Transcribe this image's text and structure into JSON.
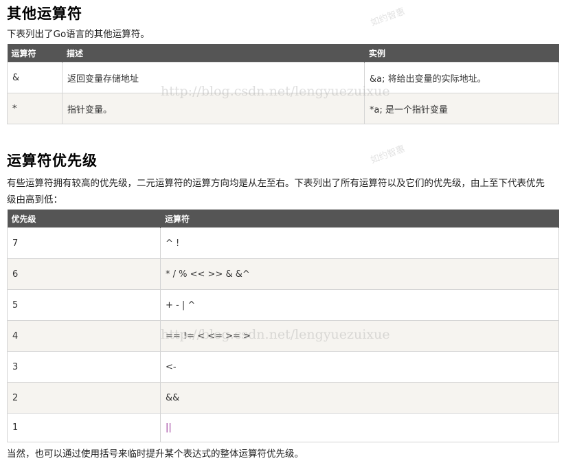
{
  "section1": {
    "title": "其他运算符",
    "intro": "下表列出了Go语言的其他运算符。",
    "headers": [
      "运算符",
      "描述",
      "实例"
    ],
    "rows": [
      [
        "&",
        "返回变量存储地址",
        "&a; 将给出变量的实际地址。"
      ],
      [
        "*",
        "指针变量。",
        "*a; 是一个指针变量"
      ]
    ]
  },
  "section2": {
    "title": "运算符优先级",
    "intro_line1": "有些运算符拥有较高的优先级，二元运算符的运算方向均是从左至右。下表列出了所有运算符以及它们的优先级，由上至下代表优先",
    "intro_line2": "级由高到低：",
    "headers": [
      "优先级",
      "运算符"
    ],
    "rows": [
      [
        "7",
        "^ !"
      ],
      [
        "6",
        "* / % << >> & &^"
      ],
      [
        "5",
        "+ - | ^"
      ],
      [
        "4",
        "== != < <= >= >"
      ],
      [
        "3",
        "<-"
      ],
      [
        "2",
        "&&"
      ],
      [
        "1",
        "||"
      ]
    ]
  },
  "footer_text": "当然，也可以通过使用括号来临时提升某个表达式的整体运算符优先级。",
  "watermarks": {
    "url": "http://blog.csdn.net/lengyuezuixue",
    "stamp": "如约智惠"
  },
  "colors": {
    "header_bg": "#555555",
    "row_alt": "#f6f4f0",
    "border": "#d4d4d4",
    "pipe": "#993399"
  }
}
